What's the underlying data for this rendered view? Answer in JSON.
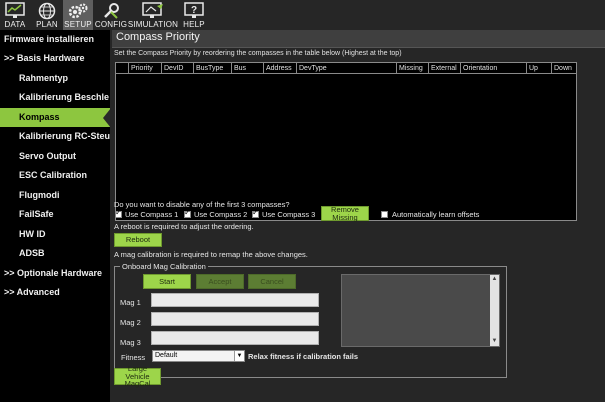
{
  "toolbar": {
    "buttons": [
      {
        "label": "DATA",
        "icon": "monitor-chart-icon"
      },
      {
        "label": "PLAN",
        "icon": "globe-icon"
      },
      {
        "label": "SETUP",
        "icon": "gears-icon",
        "active": true
      },
      {
        "label": "CONFIG",
        "icon": "wrench-icon"
      },
      {
        "label": "SIMULATION",
        "icon": "simulation-monitor-icon"
      },
      {
        "label": "HELP",
        "icon": "help-monitor-icon"
      }
    ]
  },
  "sidebar": {
    "items": [
      {
        "label": "Firmware installieren"
      },
      {
        "label": ">> Basis Hardware"
      },
      {
        "label": "Rahmentyp"
      },
      {
        "label": "Kalibrierung Beschle"
      },
      {
        "label": "Kompass",
        "active": true
      },
      {
        "label": "Kalibrierung RC-Steu"
      },
      {
        "label": "Servo Output"
      },
      {
        "label": "ESC Calibration"
      },
      {
        "label": "Flugmodi"
      },
      {
        "label": "FailSafe"
      },
      {
        "label": "HW ID"
      },
      {
        "label": "ADSB"
      },
      {
        "label": ">> Optionale Hardware"
      },
      {
        "label": ">> Advanced"
      }
    ]
  },
  "main": {
    "title": "Compass Priority",
    "description": "Set the Compass Priority by reordering the compasses in the table below (Highest at the top)",
    "table": {
      "columns": [
        "",
        "Priority",
        "DevID",
        "BusType",
        "Bus",
        "Address",
        "DevType",
        "Missing",
        "External",
        "Orientation",
        "Up",
        "Down"
      ],
      "rows": []
    },
    "disable_question": "Do you want to disable any of the first 3 compasses?",
    "use_compass_1": "Use Compass 1",
    "use_compass_2": "Use Compass 2",
    "use_compass_3": "Use Compass 3",
    "remove_missing": "Remove Missing",
    "auto_learn": "Automatically learn offsets",
    "reboot_note": "A reboot is required to adjust the ordering.",
    "reboot": "Reboot",
    "mag_note": "A mag calibration is required to remap the above changes.",
    "onboard": {
      "title": "Onboard Mag Calibration",
      "start": "Start",
      "accept": "Accept",
      "cancel": "Cancel",
      "mag1": "Mag 1",
      "mag2": "Mag 2",
      "mag3": "Mag 3",
      "fitness_label": "Fitness",
      "fitness_value": "Default",
      "relax": "Relax fitness if calibration fails"
    },
    "large_vehicle_line1": "Large Vehicle",
    "large_vehicle_line2": "MagCal"
  },
  "colors": {
    "accent_green": "#9dd54a",
    "active_nav": "#8dc63f",
    "panel_bg": "#262626",
    "sidebar_bg": "#000000"
  }
}
